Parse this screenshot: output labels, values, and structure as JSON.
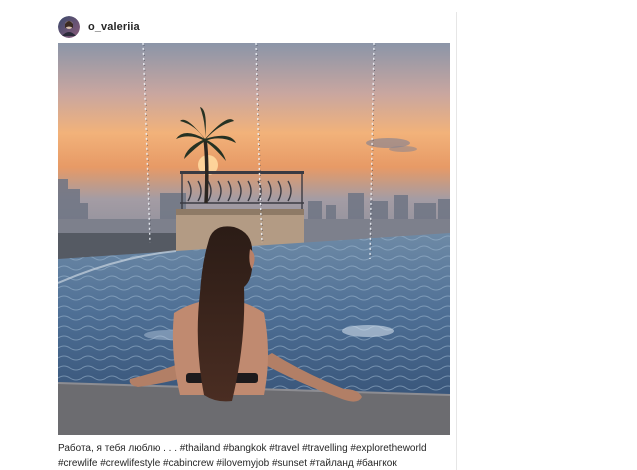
{
  "post": {
    "username": "o_valeriia",
    "caption_line1": "Работа, я тебя люблю . . . #thailand #bangkok #travel #travelling #exploretheworld",
    "caption_line2": "#crewlife #crewlifestyle #cabincrew #ilovemyjob #sunset #тайланд #бангкок"
  },
  "icons": {
    "avatar": "profile-avatar",
    "photo": "rooftop-pool-sunset-photo"
  },
  "colors": {
    "text": "#262626",
    "divider": "#e6e6e6",
    "background": "#ffffff"
  }
}
